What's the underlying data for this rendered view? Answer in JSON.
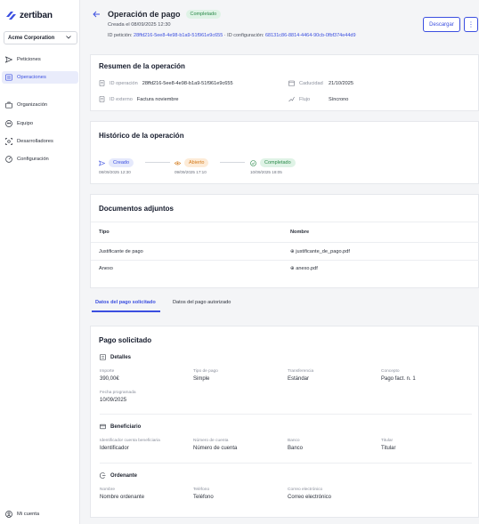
{
  "sidebar": {
    "brand": "zertiban",
    "company": "Acme Corporation",
    "items": [
      {
        "label": "Peticiones",
        "icon": "send-icon"
      },
      {
        "label": "Operaciones",
        "icon": "list-icon",
        "active": true
      },
      {
        "label": "Organización",
        "icon": "briefcase-icon"
      },
      {
        "label": "Equipo",
        "icon": "users-icon"
      },
      {
        "label": "Desarrolladores",
        "icon": "code-icon"
      },
      {
        "label": "Configuración",
        "icon": "gear-icon"
      }
    ],
    "account": "Mi cuenta"
  },
  "header": {
    "title": "Operación de pago",
    "status": "Completado",
    "created_prefix": "Creada el ",
    "created": "08/09/2025 12:30",
    "petition_label": "ID petición:",
    "petition_id": "28ffd216-5ee8-4e98-b1a9-51f961e9c655",
    "separator": "·",
    "config_label": "ID configuración:",
    "config_id": "68131c86-8814-4464-90cb-0fbf374e44d9",
    "download_label": "Descargar",
    "more_label": "⋮"
  },
  "summary": {
    "title": "Resumen de la operación",
    "op_label": "ID operación",
    "op_value": "28ffd216-5ee8-4e98-b1a9-51f961e9c655",
    "ext_label": "ID externo",
    "ext_value": "Factura noviembre",
    "exp_label": "Caducidad",
    "exp_value": "21/10/2025",
    "flow_label": "Flujo",
    "flow_value": "Síncrono"
  },
  "history": {
    "title": "Histórico de la operación",
    "steps": [
      {
        "label": "Creado",
        "date": "08/09/2025 12:30",
        "color": "#3b4fe0"
      },
      {
        "label": "Abierto",
        "date": "09/09/2025 17:10",
        "color": "#d37a1a"
      },
      {
        "label": "Completado",
        "date": "10/09/2025 18:05",
        "color": "#2b8a4a"
      }
    ]
  },
  "documents": {
    "title": "Documentos adjuntos",
    "col_type": "Tipo",
    "col_name": "Nombre",
    "rows": [
      {
        "type": "Justificante de pago",
        "name": "justificante_de_pago.pdf"
      },
      {
        "type": "Anexo",
        "name": "anexo.pdf"
      }
    ]
  },
  "tabs": [
    "Datos del pago solicitado",
    "Datos del pago autorizado"
  ],
  "payment": {
    "title": "Pago solicitado",
    "details": {
      "title": "Detalles",
      "importe_label": "Importe",
      "importe": "390,00€",
      "tipo_label": "Tipo de pago",
      "tipo": "Simple",
      "transf_label": "Transferencia",
      "transf": "Estándar",
      "concepto_label": "Concepto",
      "concepto": "Pago fact. n. 1",
      "fecha_label": "Fecha programada",
      "fecha": "10/09/2025"
    },
    "beneficiary": {
      "title": "Beneficiario",
      "id_label": "Identificador cuenta beneficiaria",
      "id": "Identificador",
      "num_label": "Número de cuenta",
      "num": "Número de cuenta",
      "bank_label": "Banco",
      "bank": "Banco",
      "holder_label": "Titular",
      "holder": "Titular"
    },
    "orderer": {
      "title": "Ordenante",
      "name_label": "Nombre",
      "name": "Nombre ordenante",
      "phone_label": "Teléfono",
      "phone": "Teléfono",
      "email_label": "Correo electrónico",
      "email": "Correo electrónico"
    }
  },
  "colors": {
    "accent": "#3b4fe0",
    "success": "#2b8a4a",
    "warning": "#d37a1a"
  }
}
